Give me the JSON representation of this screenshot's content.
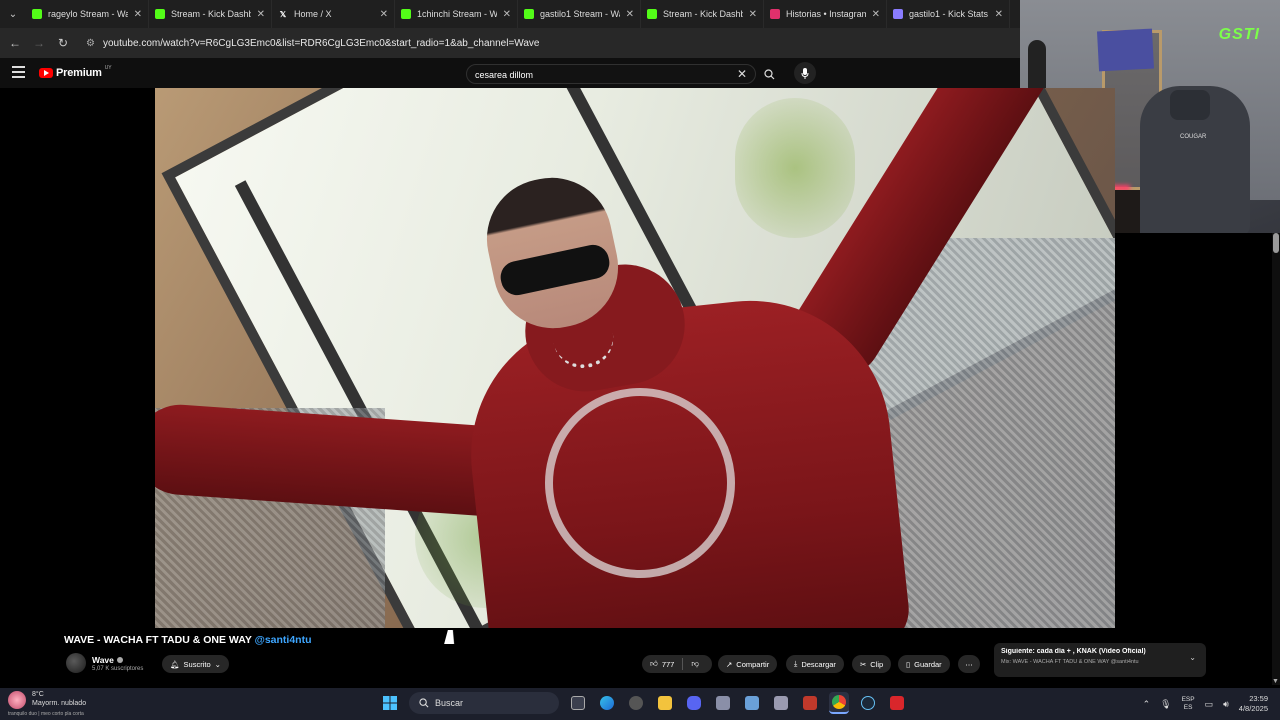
{
  "browser": {
    "tabs": [
      {
        "title": "rageylo Stream - Wa",
        "favicon": "kick-icon",
        "color": "#53fc18"
      },
      {
        "title": "Stream - Kick Dashbo",
        "favicon": "kick-icon",
        "color": "#53fc18"
      },
      {
        "title": "Home / X",
        "favicon": "x-icon",
        "color": "#ffffff"
      },
      {
        "title": "1chinchi Stream - Wa",
        "favicon": "kick-icon",
        "color": "#53fc18"
      },
      {
        "title": "gastilo1 Stream - Wa",
        "favicon": "kick-icon",
        "color": "#53fc18"
      },
      {
        "title": "Stream - Kick Dashbo",
        "favicon": "kick-icon",
        "color": "#53fc18"
      },
      {
        "title": "Historias • Instagram",
        "favicon": "instagram-icon",
        "color": "#e1306c"
      },
      {
        "title": "gastilo1 - Kick Stats",
        "favicon": "stats-icon",
        "color": "#8a7cff"
      }
    ],
    "url": "youtube.com/watch?v=R6CgLG3Emc0&list=RDR6CgLG3Emc0&start_radio=1&ab_channel=Wave"
  },
  "youtube": {
    "logo_text": "Premium",
    "logo_country": "UY",
    "search_value": "cesarea dillom"
  },
  "webcam": {
    "brand": "GSTI",
    "chair_brand": "COUGAR"
  },
  "video": {
    "title": "WAVE - WACHA FT TADU & ONE WAY",
    "mention": "@santi4ntu",
    "channel_name": "Wave",
    "subscribers": "5,07 K suscriptores",
    "subscribe_label": "Suscrito",
    "likes": "777",
    "share_label": "Compartir",
    "download_label": "Descargar",
    "clip_label": "Clip",
    "save_label": "Guardar"
  },
  "next_up": {
    "line1": "Siguiente: cada día + , KNAK (Video Oficial)",
    "line2": "Mix: WAVE - WACHA FT TADU & ONE WAY @santi4ntu"
  },
  "taskbar": {
    "temperature": "8°C",
    "condition": "Mayorm. nublado",
    "note": "tranquilo duo | meo corto pla corta",
    "search_placeholder": "Buscar",
    "lang_top": "ESP",
    "lang_bottom": "ES",
    "time": "23:59",
    "date": "4/8/2025"
  },
  "colors": {
    "accent_link": "#3ea6ff",
    "youtube_red": "#ff0000",
    "kick_green": "#53fc18"
  }
}
